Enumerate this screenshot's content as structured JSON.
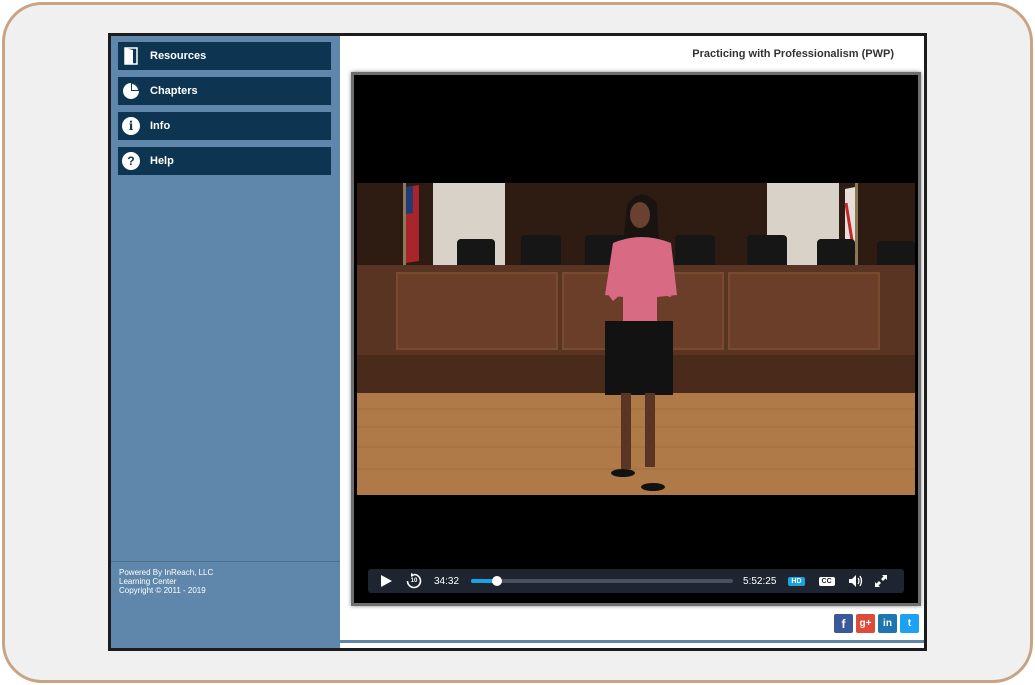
{
  "sidebar": {
    "items": [
      {
        "label": "Resources",
        "icon": "door-icon"
      },
      {
        "label": "Chapters",
        "icon": "pie-chart-icon"
      },
      {
        "label": "Info",
        "icon": "info-icon"
      },
      {
        "label": "Help",
        "icon": "help-icon"
      }
    ],
    "footer": {
      "line1": "Powered By InReach, LLC",
      "line2": "Learning Center",
      "line3": "Copyright © 2011 - 2019"
    }
  },
  "header": {
    "course_title": "Practicing with Professionalism (PWP)"
  },
  "player": {
    "current_time": "34:32",
    "duration": "5:52:25",
    "progress_fraction": 0.1,
    "hd_label": "HD",
    "cc_label": "CC",
    "rewind_label": "10"
  },
  "social": {
    "facebook": "f",
    "googleplus": "g+",
    "linkedin": "in",
    "twitter": "t"
  },
  "colors": {
    "sidebar_bg": "#5e87ab",
    "nav_button_bg": "#0d3450",
    "accent": "#1aa3e0"
  }
}
